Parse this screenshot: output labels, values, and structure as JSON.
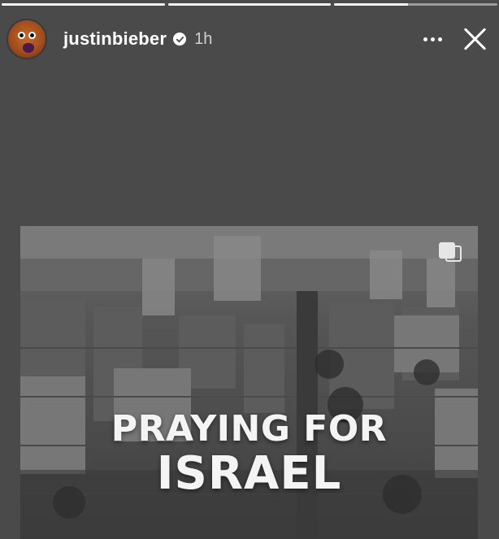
{
  "story": {
    "progress": [
      1,
      1,
      0.45
    ],
    "username": "justinbieber",
    "verified": true,
    "time": "1h",
    "more_icon": "more-horizontal-icon",
    "close_icon": "close-icon"
  },
  "post": {
    "multi_icon": "multiple-images-icon",
    "caption_line1": "PRAYING FOR",
    "caption_line2": "ISRAEL"
  },
  "colors": {
    "background": "#4a4a4a",
    "text": "#ffffff",
    "muted_text": "#cfcfcf"
  }
}
